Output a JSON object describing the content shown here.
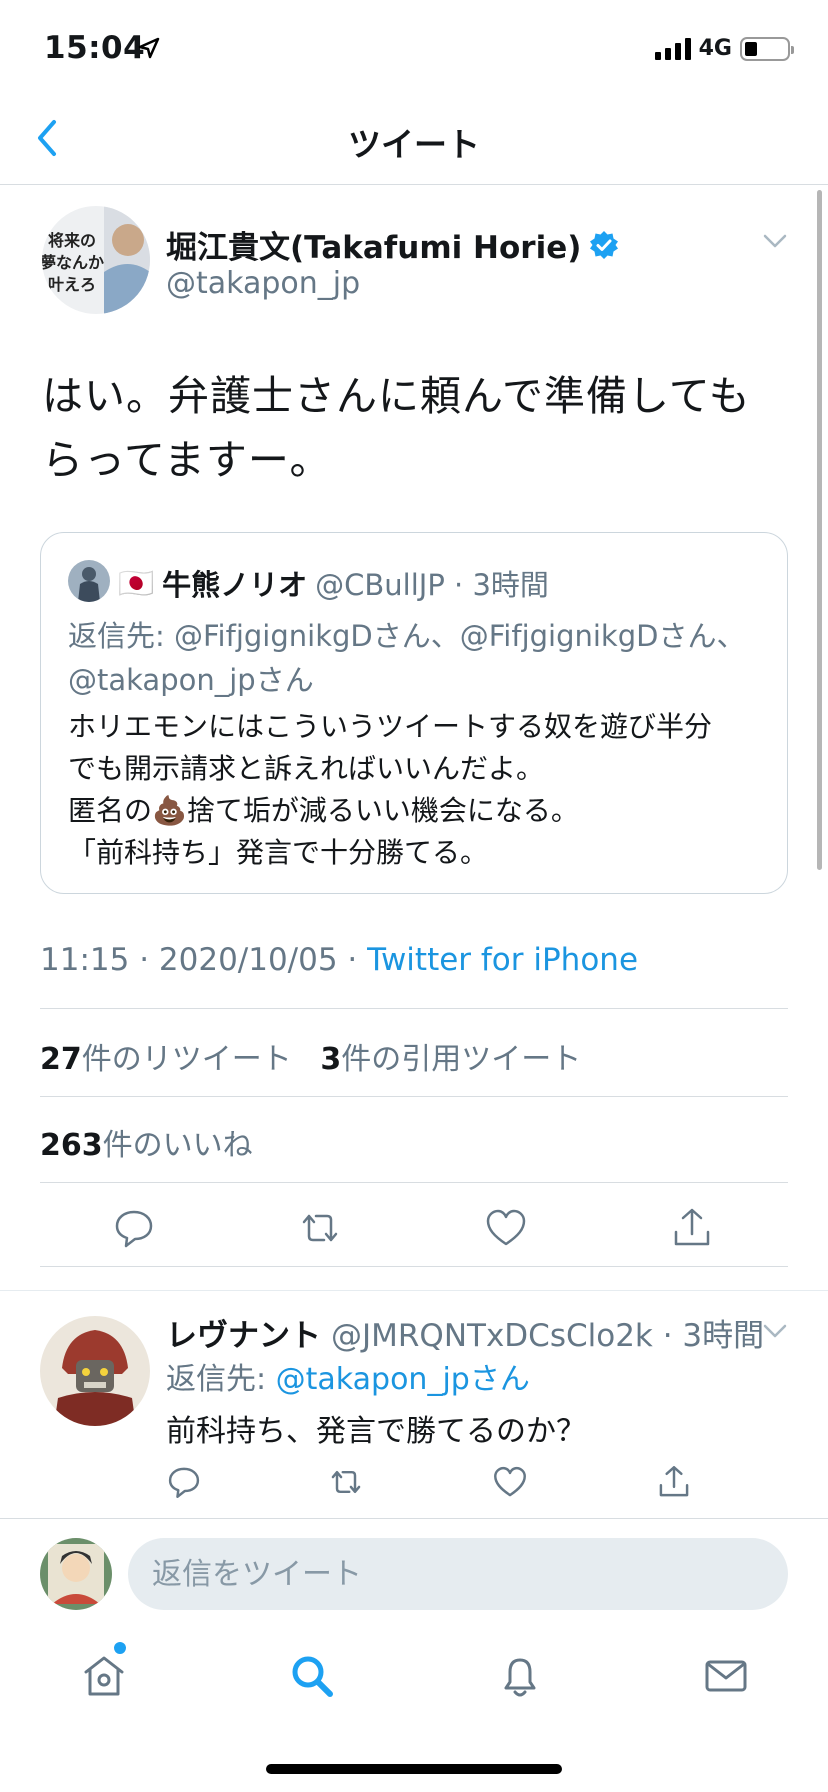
{
  "status_bar": {
    "time": "15:04",
    "network": "4G"
  },
  "nav": {
    "title": "ツイート"
  },
  "tweet": {
    "author_name": "堀江貴文(Takafumi Horie)",
    "author_handle": "@takapon_jp",
    "text": "はい。弁護士さんに頼んで準備してもらってますー。",
    "timestamp": "11:15 · 2020/10/05 · ",
    "source": "Twitter for iPhone",
    "retweets_count": "27",
    "retweets_label": "件のリツイート",
    "quotes_count": "3",
    "quotes_label": "件の引用ツイート",
    "likes_count": "263",
    "likes_label": "件のいいね",
    "avatar_text": "将来の夢なんか、いま叶えろ。"
  },
  "quoted": {
    "flag": "🇯🇵",
    "author_name": "牛熊ノリオ",
    "meta": "@CBullJP · 3時間",
    "reply_to_1": "返信先: @FifjgignikgDさん、@FifjgignikgDさん、",
    "reply_to_2": "@takapon_jpさん",
    "line_1": "ホリエモンにはこういうツイートする奴を遊び半分",
    "line_2": "でも開示請求と訴えればいいんだよ。",
    "line_3a": "匿名の",
    "poop_emoji": "💩",
    "line_3b": "捨て垢が減るいい機会になる。",
    "line_4": "「前科持ち」発言で十分勝てる。"
  },
  "reply": {
    "author_name": "レヴナント",
    "meta": "@JMRQNTxDCsClo2k · 3時間",
    "reply_prefix": "返信先: ",
    "reply_mention": "@takapon_jpさん",
    "text": "前科持ち、発言で勝てるのか？"
  },
  "compose": {
    "placeholder": "返信をツイート"
  },
  "colors": {
    "accent": "#1da1f2",
    "link": "#1b95e0",
    "muted": "#657786"
  }
}
